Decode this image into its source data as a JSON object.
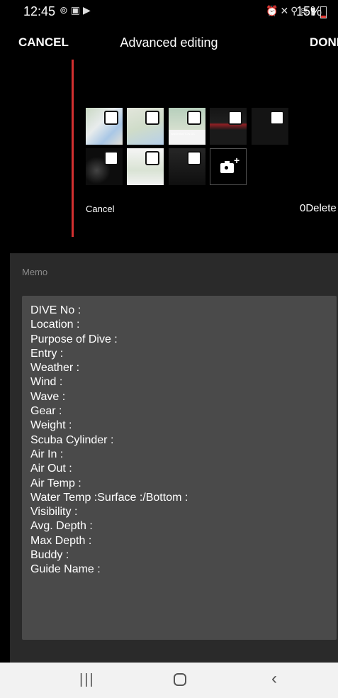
{
  "status_bar": {
    "time": "12:45",
    "battery": "15%",
    "left_icons": [
      "alarm-icon",
      "gallery-icon",
      "youtube-icon"
    ],
    "right_icons": [
      "alarm-icon",
      "mute-icon",
      "location-icon",
      "wifi-icon",
      "signal-icon"
    ]
  },
  "top_bar": {
    "cancel_label": "CANCEL",
    "title": "Advanced editing",
    "done_label": "DONE"
  },
  "image_grid": {
    "thumbnails": [
      {
        "icon": "map-thumbnail",
        "checked": false
      },
      {
        "icon": "map-thumbnail",
        "checked": false
      },
      {
        "icon": "map-thumbnail",
        "checked": false,
        "caption": "WASHINGTON DC"
      },
      {
        "icon": "screenshot-thumbnail",
        "checked": false
      },
      {
        "icon": "screenshot-thumbnail",
        "checked": false
      },
      {
        "icon": "screenshot-thumbnail",
        "checked": false
      },
      {
        "icon": "map-thumbnail",
        "checked": false
      },
      {
        "icon": "screenshot-thumbnail",
        "checked": false
      }
    ],
    "add_photo_icon": "camera-plus-icon",
    "cancel_label": "Cancel",
    "delete_label": "0Delete"
  },
  "memo": {
    "label": "Memo",
    "lines": [
      "DIVE No :",
      "Location :",
      "Purpose of Dive :",
      "Entry :",
      "Weather :",
      "Wind :",
      "Wave :",
      "Gear :",
      "Weight :",
      "Scuba Cylinder :",
      "Air In :",
      "Air Out :",
      "Air Temp :",
      "Water Temp :Surface :/Bottom :",
      "Visibility :",
      "Avg. Depth :",
      "Max Depth :",
      "Buddy :",
      "Guide Name :"
    ]
  },
  "nav_bar": {
    "recent_icon": "recent-apps-icon",
    "home_icon": "home-icon",
    "back_icon": "back-icon"
  },
  "colors": {
    "background": "#000000",
    "accent_bar": "#d32f2f",
    "memo_section": "#2a2a2a",
    "memo_box": "#4a4a4a",
    "nav_bar": "#f2f2f2"
  }
}
